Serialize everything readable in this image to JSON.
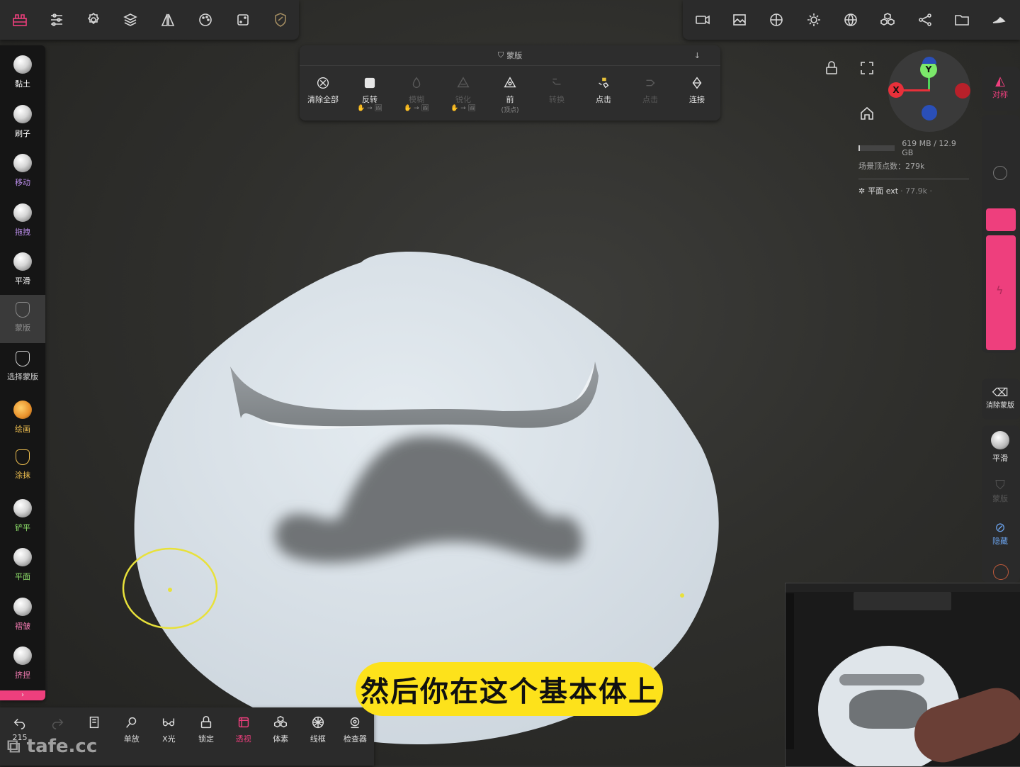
{
  "top_left_icons": [
    "logo-icon",
    "sliders-icon",
    "settings-gear-icon",
    "layers-icon",
    "symmetry-icon",
    "palette-icon",
    "dice-icon",
    "mask-shield-icon"
  ],
  "top_right_icons": [
    "camera-icon",
    "image-icon",
    "material-icon",
    "light-icon",
    "sphere-grid-icon",
    "voxel-icon",
    "share-icon",
    "folder-icon",
    "hand-icon"
  ],
  "left_tools": [
    {
      "label": "黏土",
      "color": "#ffffff"
    },
    {
      "label": "刷子",
      "color": "#ffffff"
    },
    {
      "label": "移动",
      "color": "#b98ce8"
    },
    {
      "label": "拖拽",
      "color": "#b98ce8"
    },
    {
      "label": "平滑",
      "color": "#ffffff"
    },
    {
      "label": "蒙版",
      "color": "#8a8a8a"
    },
    {
      "label": "选择蒙版",
      "color": "#cfcfcf"
    },
    {
      "label": "绘画",
      "color": "#f0c050"
    },
    {
      "label": "涂抹",
      "color": "#f0c050"
    },
    {
      "label": "铲平",
      "color": "#8ee06a"
    },
    {
      "label": "平面",
      "color": "#8ee06a"
    },
    {
      "label": "褶皱",
      "color": "#f07ab0"
    },
    {
      "label": "挤捏",
      "color": "#f07ab0"
    }
  ],
  "mask_bar": {
    "title": "蒙版",
    "tools": [
      {
        "label": "清除全部",
        "sub": "",
        "dim": false
      },
      {
        "label": "反转",
        "sub": "✋ → 🖼",
        "dim": false
      },
      {
        "label": "模糊",
        "sub": "✋ → 🖼",
        "dim": true
      },
      {
        "label": "锐化",
        "sub": "✋ → 🖼",
        "dim": true
      },
      {
        "label": "前",
        "sub": "(顶点)",
        "dim": false
      },
      {
        "label": "转换",
        "sub": "",
        "dim": true
      },
      {
        "label": "点击",
        "sub": "",
        "dim": false
      },
      {
        "label": "点击",
        "sub": "",
        "dim": true
      },
      {
        "label": "连接",
        "sub": "",
        "dim": false
      }
    ]
  },
  "stats": {
    "memory": "619 MB / 12.9 GB",
    "vertices": "场景顶点数：279k",
    "object": "平面 ext",
    "object_count": "· 77.9k ·"
  },
  "gizmo": {
    "y_label": "Y",
    "x_label": "X"
  },
  "right_tools": {
    "symmetry": "对称",
    "clear_mask": "消除蒙版",
    "smooth": "平滑",
    "mask": "蒙版",
    "hide": "隐藏"
  },
  "bottom_tools": [
    {
      "label": "215",
      "icon": "undo-icon"
    },
    {
      "label": "",
      "icon": "redo-icon"
    },
    {
      "label": "",
      "icon": "book-icon"
    },
    {
      "label": "单放",
      "icon": "zoom-icon"
    },
    {
      "label": "X光",
      "icon": "glasses-icon"
    },
    {
      "label": "锁定",
      "icon": "lock-icon"
    },
    {
      "label": "透视",
      "icon": "perspective-icon"
    },
    {
      "label": "体素",
      "icon": "voxel-icon"
    },
    {
      "label": "线框",
      "icon": "wireframe-icon"
    },
    {
      "label": "检查器",
      "icon": "inspector-icon"
    }
  ],
  "subtitle": "然后你在这个基本体上",
  "watermark": "tafe.cc",
  "colors": {
    "accent_pink": "#ee3f7d",
    "subtitle_bg": "#fde21b",
    "cursor": "#e8e13a",
    "clay": "#dbe3e9"
  }
}
